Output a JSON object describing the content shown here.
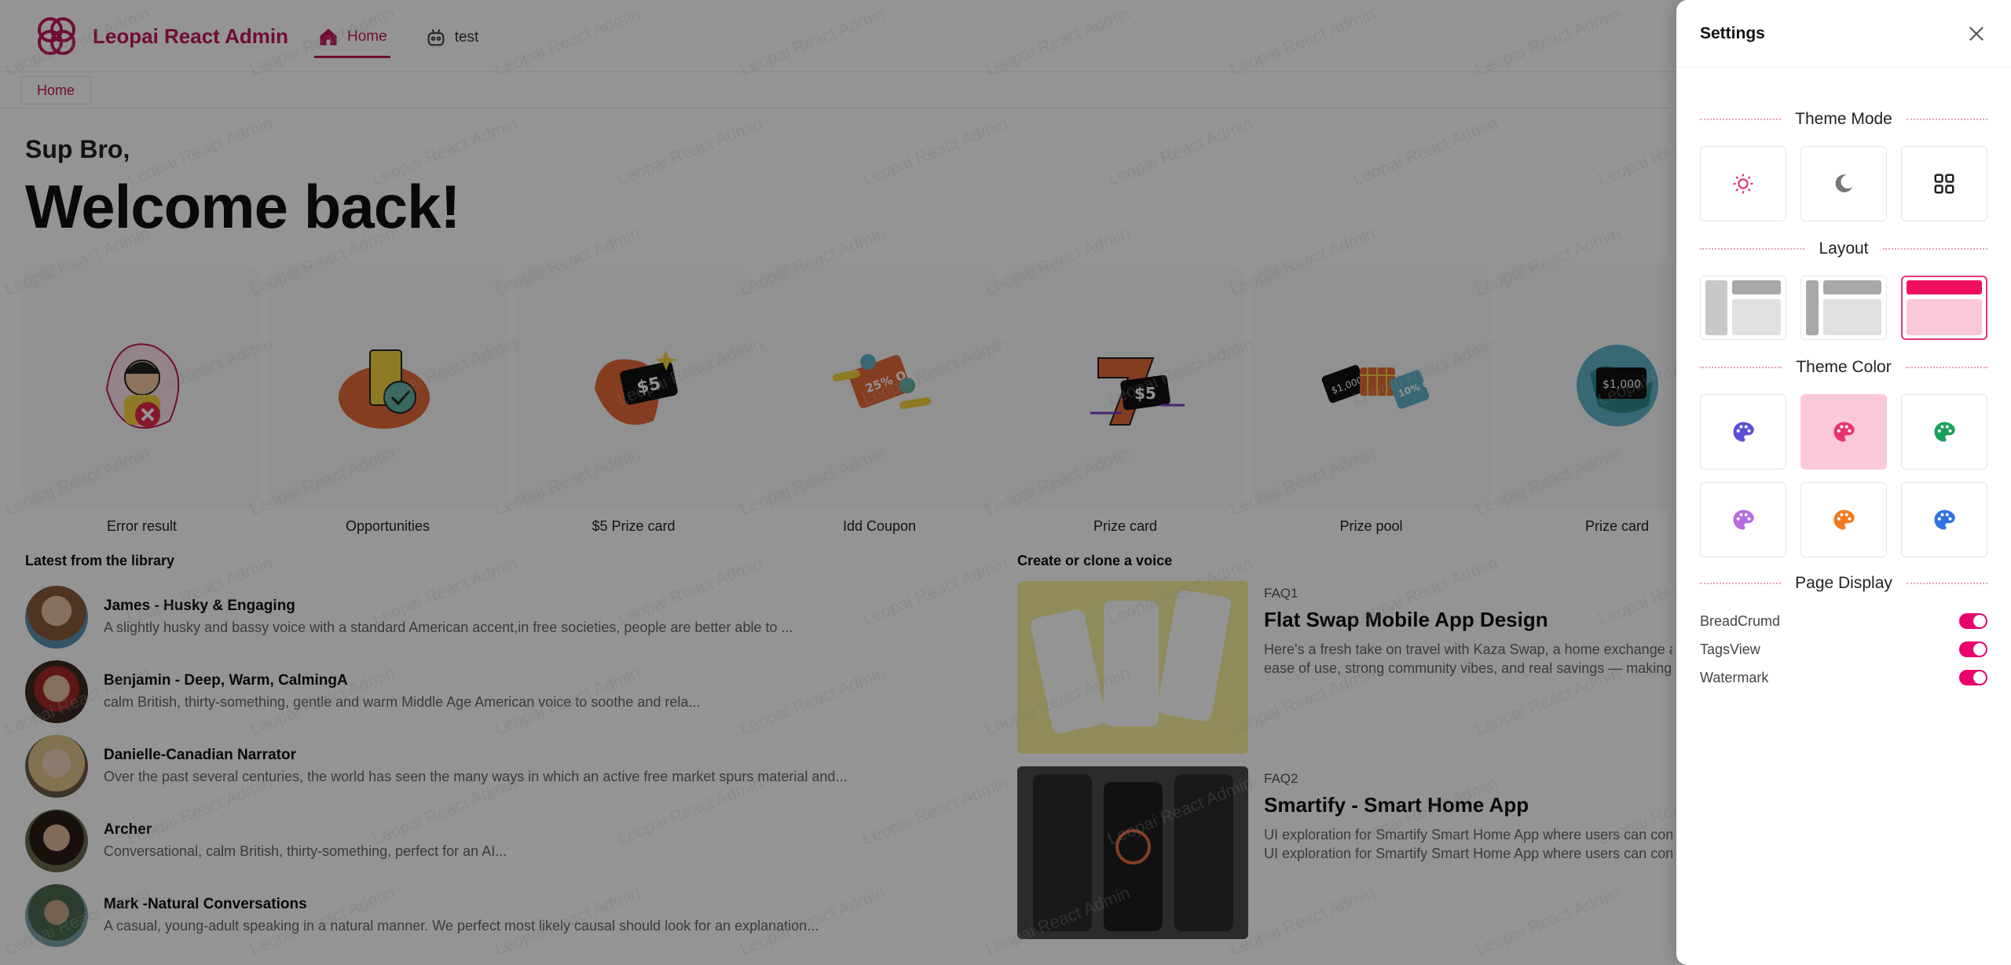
{
  "app": {
    "title": "Leopai React Admin",
    "brand_color": "#c2185b"
  },
  "nav": [
    {
      "label": "Home",
      "icon": "home-icon",
      "active": true
    },
    {
      "label": "test",
      "icon": "robot-icon",
      "active": false
    }
  ],
  "tags": {
    "home": "Home"
  },
  "greeting": {
    "small": "Sup Bro,",
    "big": "Welcome back!"
  },
  "cards": [
    {
      "label": "Error result",
      "icon": "error-person-illustration"
    },
    {
      "label": "Opportunities",
      "icon": "ticket-check-illustration"
    },
    {
      "label": "$5 Prize card",
      "icon": "prize-card-illustration"
    },
    {
      "label": "Idd Coupon",
      "icon": "coupon-illustration"
    },
    {
      "label": "Prize card",
      "icon": "seven-prize-illustration"
    },
    {
      "label": "Prize pool",
      "icon": "prize-pool-illustration"
    },
    {
      "label": "Prize card",
      "icon": "globe-prize-illustration"
    }
  ],
  "library": {
    "title": "Latest from the library",
    "items": [
      {
        "name": "James - Husky & Engaging",
        "desc": "A slightly husky and bassy voice with a standard American accent,in free societies, people are better able to ..."
      },
      {
        "name": "Benjamin - Deep, Warm, CalmingA",
        "desc": "calm British, thirty-something, gentle and warm Middle Age American voice to soothe and rela..."
      },
      {
        "name": "Danielle-Canadian Narrator",
        "desc": "Over the past several centuries, the world has seen the many ways in which an active free market spurs material and..."
      },
      {
        "name": "Archer",
        "desc": "Conversational, calm British, thirty-something, perfect for an AI..."
      },
      {
        "name": "Mark -Natural Conversations",
        "desc": "A casual, young-adult speaking in a natural manner. We perfect most likely causal should look for an explanation..."
      }
    ]
  },
  "voices": {
    "title": "Create or clone a voice",
    "items": [
      {
        "faq": "FAQ1",
        "title": "Flat Swap Mobile App Design",
        "desc1": "Here's a fresh take on travel with Kaza Swap, a home exchange app that",
        "desc2": "ease of use, strong community vibes, and real savings — making it a"
      },
      {
        "faq": "FAQ2",
        "title": "Smartify - Smart Home App",
        "desc1": "UI exploration for Smartify Smart Home App where users can control",
        "desc2": "UI exploration for Smartify Smart Home App where users can control"
      }
    ]
  },
  "watermark": "Leopai React Admin",
  "settings": {
    "title": "Settings",
    "theme_mode_label": "Theme Mode",
    "layout_label": "Layout",
    "theme_color_label": "Theme Color",
    "page_display_label": "Page Display",
    "theme_modes": [
      "sun-icon",
      "moon-icon",
      "grid-icon"
    ],
    "layouts": [
      "sidebar-layout",
      "mixed-layout",
      "top-layout"
    ],
    "theme_colors": [
      "#5b4fd6",
      "#e9356f",
      "#1aa05a",
      "#b56be0",
      "#f07b1e",
      "#2f73e0"
    ],
    "selected_color": "#e9356f",
    "toggles": [
      {
        "label": "BreadCrumd",
        "on": true
      },
      {
        "label": "TagsView",
        "on": true
      },
      {
        "label": "Watermark",
        "on": true
      }
    ]
  }
}
